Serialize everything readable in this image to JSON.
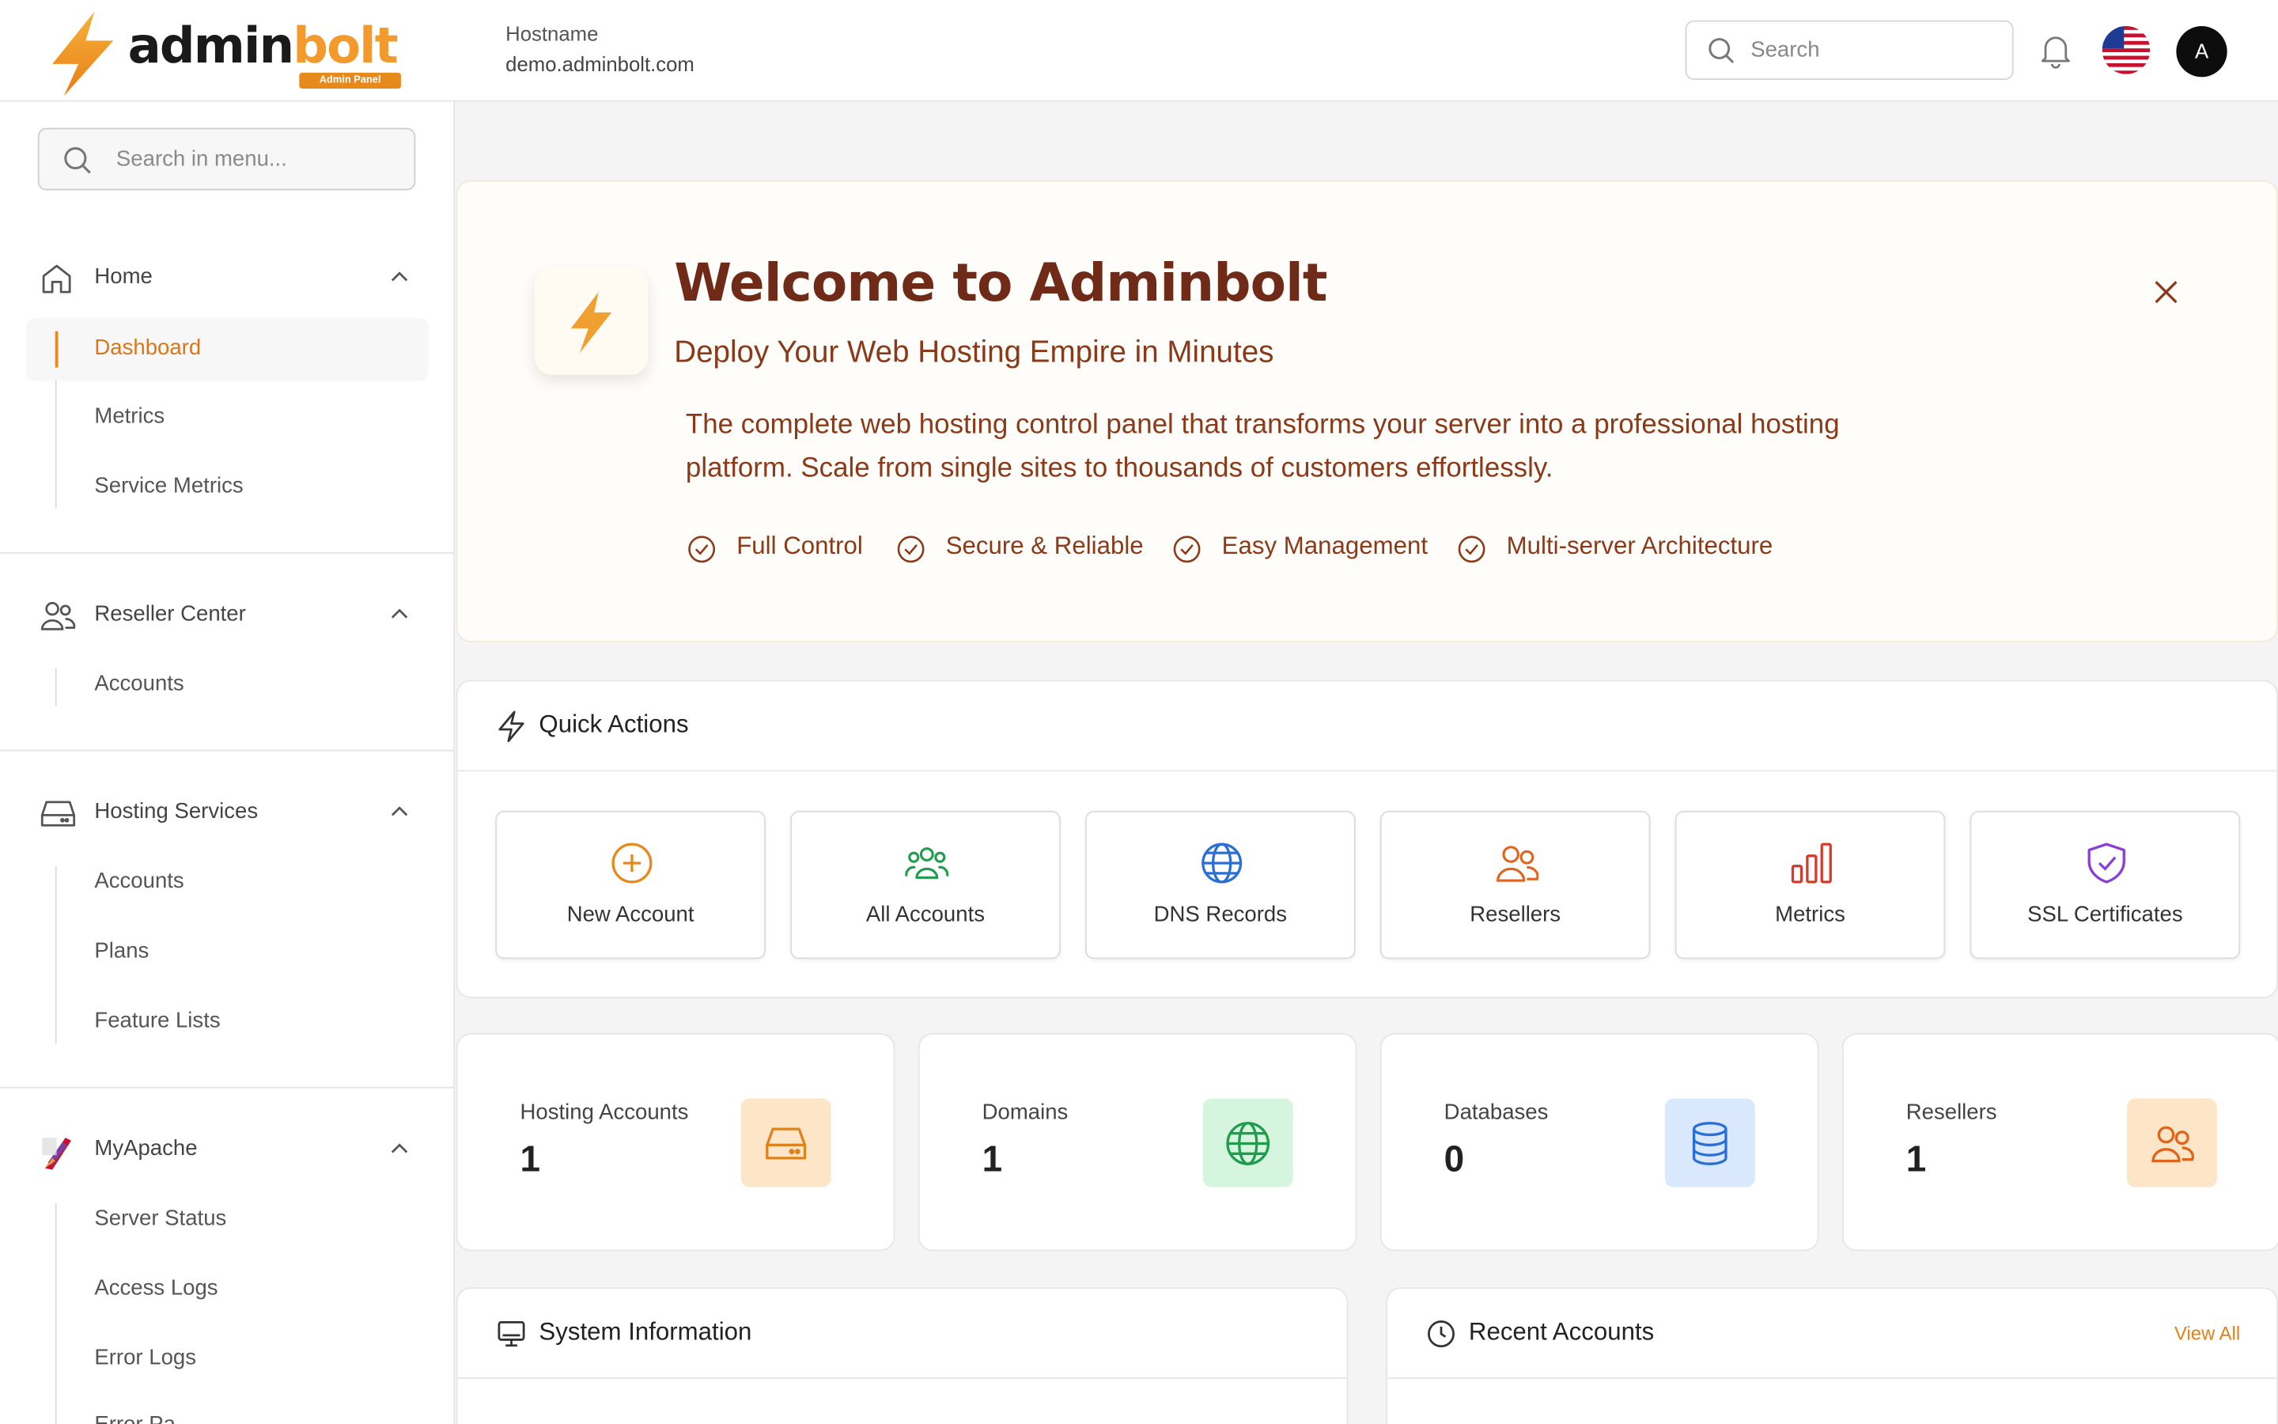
{
  "brand": {
    "name_part1": "admin",
    "name_part2": "bolt",
    "badge": "Admin Panel",
    "accent_color": "#f29a2e"
  },
  "header": {
    "hostname_label": "Hostname",
    "hostname_value": "demo.adminbolt.com",
    "search_placeholder": "Search",
    "avatar_initial": "A",
    "icons": [
      "search-icon",
      "bell-icon",
      "us-flag-icon"
    ]
  },
  "sidebar": {
    "search_placeholder": "Search in menu...",
    "sections": [
      {
        "title": "Home",
        "icon": "home-icon",
        "items": [
          "Dashboard",
          "Metrics",
          "Service Metrics"
        ],
        "active": "Dashboard"
      },
      {
        "title": "Reseller Center",
        "icon": "users-icon",
        "items": [
          "Accounts"
        ]
      },
      {
        "title": "Hosting Services",
        "icon": "server-icon",
        "items": [
          "Accounts",
          "Plans",
          "Feature Lists"
        ]
      },
      {
        "title": "MyApache",
        "icon": "apache-feather-icon",
        "items": [
          "Server Status",
          "Access Logs",
          "Error Logs",
          "Error Pa..."
        ]
      }
    ]
  },
  "welcome": {
    "title": "Welcome to Adminbolt",
    "subtitle": "Deploy Your Web Hosting Empire in Minutes",
    "description": "The complete web hosting control panel that transforms your server into a professional hosting platform. Scale from single sites to thousands of customers effortlessly.",
    "features": [
      "Full Control",
      "Secure & Reliable",
      "Easy Management",
      "Multi-server Architecture"
    ]
  },
  "quick_actions": {
    "title": "Quick Actions",
    "items": [
      {
        "label": "New Account",
        "icon": "plus-circle-icon",
        "color": "#e6891e"
      },
      {
        "label": "All Accounts",
        "icon": "users-group-icon",
        "color": "#1f9d4c"
      },
      {
        "label": "DNS Records",
        "icon": "globe-icon",
        "color": "#2b6fd6"
      },
      {
        "label": "Resellers",
        "icon": "users-icon",
        "color": "#e0641c"
      },
      {
        "label": "Metrics",
        "icon": "bar-chart-icon",
        "color": "#d63a2b"
      },
      {
        "label": "SSL Certificates",
        "icon": "shield-check-icon",
        "color": "#8a3fd6"
      }
    ]
  },
  "stats": [
    {
      "label": "Hosting Accounts",
      "value": "1",
      "icon": "server-icon",
      "bg": "#fde5c8",
      "color": "#e0821c"
    },
    {
      "label": "Domains",
      "value": "1",
      "icon": "globe-icon",
      "bg": "#d6f5df",
      "color": "#1f9d4c"
    },
    {
      "label": "Databases",
      "value": "0",
      "icon": "database-icon",
      "bg": "#d9e8fc",
      "color": "#2b6fd6"
    },
    {
      "label": "Resellers",
      "value": "1",
      "icon": "users-icon",
      "bg": "#fde5c8",
      "color": "#e0641c"
    }
  ],
  "panels": {
    "system_info_title": "System Information",
    "recent_accounts_title": "Recent Accounts",
    "view_all": "View All"
  }
}
